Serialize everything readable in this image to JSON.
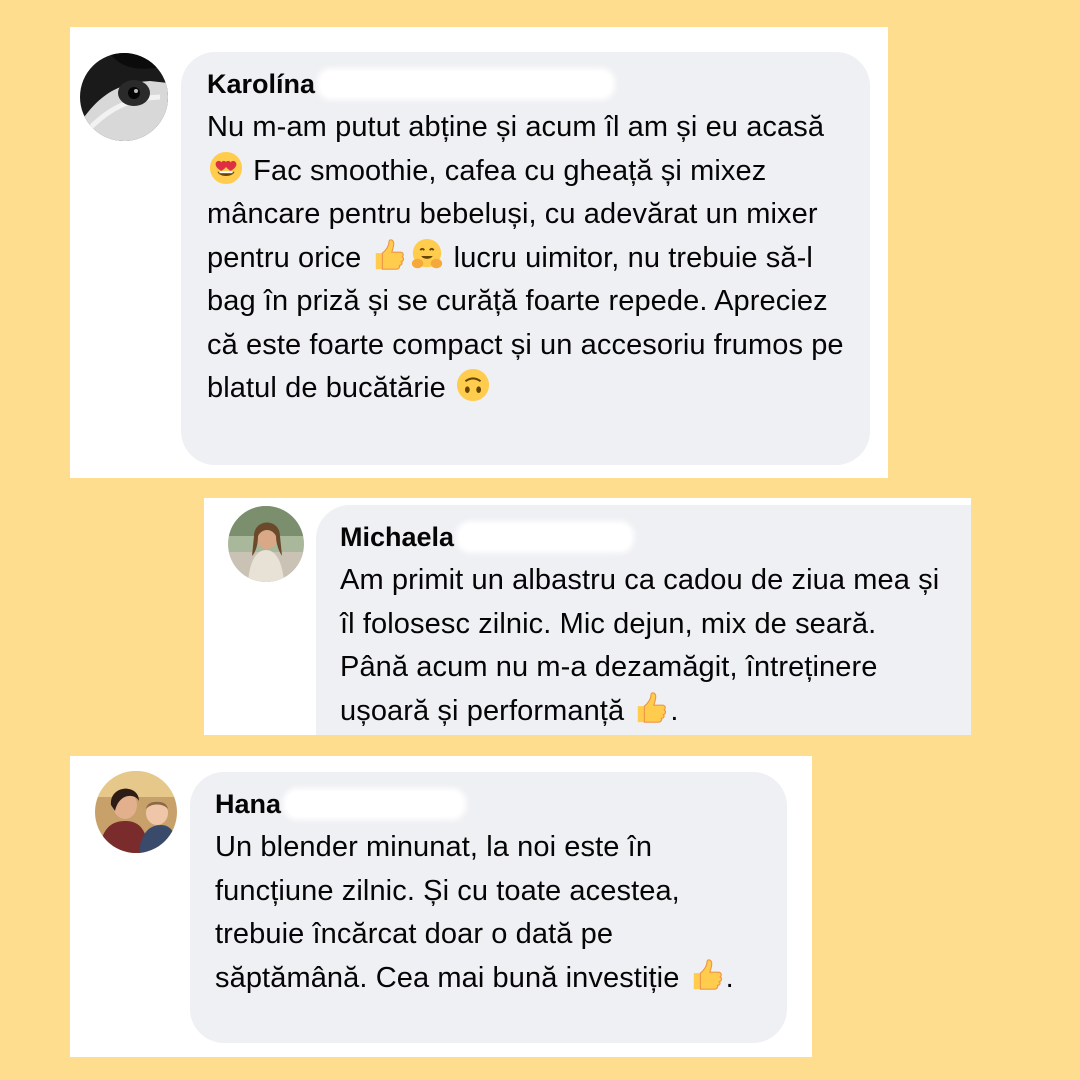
{
  "background_color": "#FEDD8E",
  "comments": [
    {
      "author": "Karolína",
      "avatar": "bw-animal-photo",
      "segments": [
        {
          "t": "Nu m-am putut abține și acum îl am și eu acasă "
        },
        {
          "emoji": "heart-eyes-emoji"
        },
        {
          "t": " Fac smoothie, cafea cu gheață și mixez mâncare pentru bebeluși, cu adevărat un mixer pentru orice "
        },
        {
          "emoji": "thumbs-up-emoji"
        },
        {
          "emoji": "hugging-face-emoji"
        },
        {
          "t": " lucru uimitor, nu trebuie să-l bag în priză și se curăță foarte repede. Apreciez că este foarte compact și un accesoriu frumos pe blatul de bucătărie "
        },
        {
          "emoji": "upside-down-face-emoji"
        }
      ]
    },
    {
      "author": "Michaela",
      "avatar": "woman-outdoor-photo",
      "segments": [
        {
          "t": "Am primit un albastru ca cadou de ziua mea și îl folosesc zilnic. Mic dejun, mix de seară. Până acum nu m-a dezamăgit, întreținere ușoară și performanță "
        },
        {
          "emoji": "thumbs-up-emoji"
        },
        {
          "t": "."
        }
      ]
    },
    {
      "author": "Hana",
      "avatar": "woman-with-baby-photo",
      "segments": [
        {
          "t": "Un blender minunat, la noi este în funcțiune zilnic. Și cu toate acestea, trebuie încărcat doar o dată pe săptămână. Cea mai bună investiție "
        },
        {
          "emoji": "thumbs-up-emoji"
        },
        {
          "t": "."
        }
      ]
    }
  ]
}
